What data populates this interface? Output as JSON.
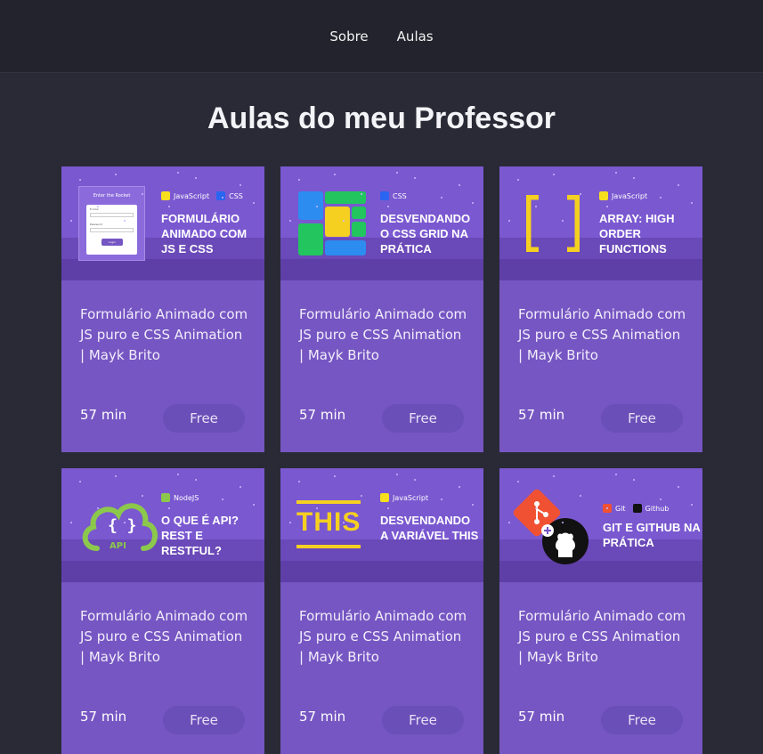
{
  "nav": {
    "items": [
      "Sobre",
      "Aulas"
    ]
  },
  "page": {
    "title": "Aulas do meu Professor"
  },
  "cards": [
    {
      "thumb_title": "Formulário animado com JS e CSS",
      "tags": [
        {
          "label": "JavaScript",
          "color": "#f7df1e",
          "icon": "js-icon"
        },
        {
          "label": "CSS",
          "color": "#2965f1",
          "icon": "css-icon"
        }
      ],
      "art": "form",
      "art_heading": "Enter the Rocket",
      "art_email": "E-mail",
      "art_password": "Password",
      "art_button": "Login",
      "title": "Formulário Animado com JS puro e CSS Animation | Mayk Brito",
      "duration": "57 min",
      "price": "Free"
    },
    {
      "thumb_title": "Desvendando o CSS Grid na prática",
      "tags": [
        {
          "label": "CSS",
          "color": "#2965f1",
          "icon": "css-icon"
        }
      ],
      "art": "grid",
      "title": "Formulário Animado com JS puro e CSS Animation | Mayk Brito",
      "duration": "57 min",
      "price": "Free"
    },
    {
      "thumb_title": "Array: High Order Functions",
      "tags": [
        {
          "label": "JavaScript",
          "color": "#f7df1e",
          "icon": "js-icon"
        }
      ],
      "art": "brackets",
      "title": "Formulário Animado com JS puro e CSS Animation | Mayk Brito",
      "duration": "57 min",
      "price": "Free"
    },
    {
      "thumb_title": "O que é API? Rest e Restful?",
      "tags": [
        {
          "label": "NodeJS",
          "color": "#8cc84b",
          "icon": "nodejs-icon"
        }
      ],
      "art": "api",
      "art_label": "API",
      "title": "Formulário Animado com JS puro e CSS Animation | Mayk Brito",
      "duration": "57 min",
      "price": "Free"
    },
    {
      "thumb_title": "Desvendando a variável this",
      "tags": [
        {
          "label": "JavaScript",
          "color": "#f7df1e",
          "icon": "js-icon"
        }
      ],
      "art": "this",
      "art_label": "THIS",
      "title": "Formulário Animado com JS puro e CSS Animation | Mayk Brito",
      "duration": "57 min",
      "price": "Free"
    },
    {
      "thumb_title": "Git e Github na prática",
      "tags": [
        {
          "label": "Git",
          "color": "#f05133",
          "icon": "git-icon"
        },
        {
          "label": "Github",
          "color": "#111111",
          "icon": "github-icon"
        }
      ],
      "art": "git",
      "title": "Formulário Animado com JS puro e CSS Animation | Mayk Brito",
      "duration": "57 min",
      "price": "Free"
    }
  ]
}
